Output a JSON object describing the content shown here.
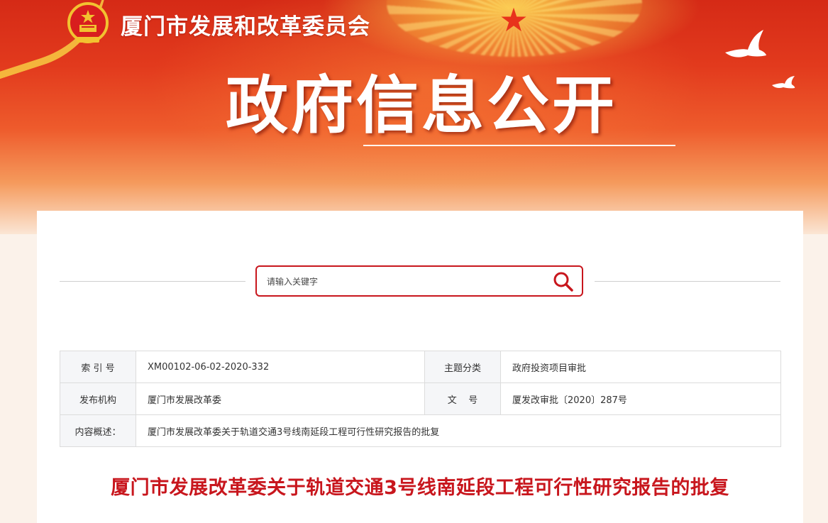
{
  "header": {
    "agency_name": "厦门市发展和改革委员会",
    "page_title": "政府信息公开",
    "colors": {
      "banner_red": "#d52a16",
      "accent_red": "#c8161d",
      "gold": "#f7c340"
    }
  },
  "search": {
    "placeholder": "请输入关键字",
    "icon": "search-icon"
  },
  "info": {
    "index_label": "索 引 号",
    "index_value": "XM00102-06-02-2020-332",
    "topic_label": "主题分类",
    "topic_value": "政府投资项目审批",
    "publisher_label": "发布机构",
    "publisher_value": "厦门市发展改革委",
    "docno_label": "文    号",
    "docno_value": "厦发改审批〔2020〕287号",
    "summary_label": "内容概述：",
    "summary_value": "厦门市发展改革委关于轨道交通3号线南延段工程可行性研究报告的批复"
  },
  "document": {
    "title": "厦门市发展改革委关于轨道交通3号线南延段工程可行性研究报告的批复"
  }
}
